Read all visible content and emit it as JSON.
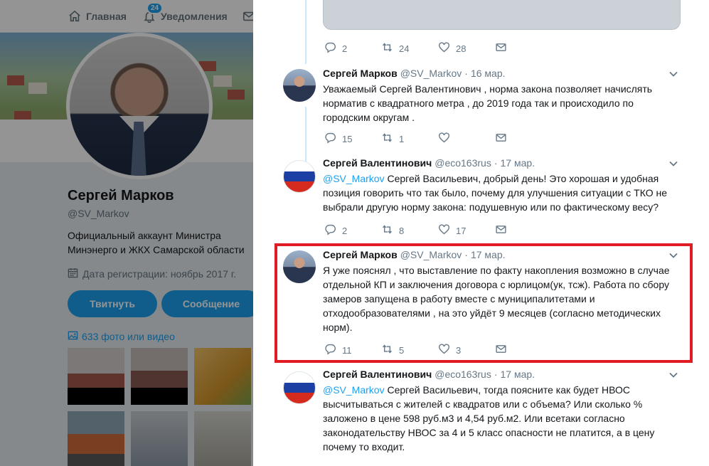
{
  "nav": {
    "home_label": "Главная",
    "notifications_label": "Уведомления",
    "notifications_count": "24"
  },
  "profile": {
    "name": "Сергей Марков",
    "handle": "@SV_Markov",
    "bio": "Официальный аккаунт Министра Минэнерго и ЖКХ Самарской области",
    "joined": "Дата регистрации: ноябрь 2017 г.",
    "tweet_button": "Твитнуть",
    "message_button": "Сообщение",
    "media_link": "633 фото или видео"
  },
  "thread": {
    "top_actions": {
      "replies": "2",
      "retweets": "24",
      "likes": "28"
    },
    "tweets": [
      {
        "name": "Сергей Марков",
        "handle": "@SV_Markov",
        "sep": "·",
        "date": "16 мар.",
        "mention": "",
        "text": "Уважаемый Сергей Валентинович , норма закона позволяет начислять норматив с квадратного метра , до 2019 года так и происходило по городским округам .",
        "replies": "15",
        "retweets": "1",
        "likes": ""
      },
      {
        "name": "Сергей Валентинович",
        "handle": "@eco163rus",
        "sep": "·",
        "date": "17 мар.",
        "mention": "@SV_Markov",
        "text": " Сергей Васильевич, добрый день! Это хорошая и удобная позиция говорить что так было, почему для улучшения ситуации с ТКО не выбрали другую норму закона: подушевную или по фактическому весу?",
        "replies": "2",
        "retweets": "8",
        "likes": "17"
      },
      {
        "name": "Сергей Марков",
        "handle": "@SV_Markov",
        "sep": "·",
        "date": "17 мар.",
        "mention": "",
        "text": "Я уже пояснял , что выставление по факту накопления возможно в случае отдельной КП и заключения договора с юрлицом(ук, тсж). Работа по сбору замеров запущена в работу вместе с муниципалитетами и отходообразователями , на это уйдёт 9 месяцев (согласно методических норм).",
        "replies": "11",
        "retweets": "5",
        "likes": "3"
      },
      {
        "name": "Сергей Валентинович",
        "handle": "@eco163rus",
        "sep": "·",
        "date": "17 мар.",
        "mention": "@SV_Markov",
        "text": " Сергей Васильевич, тогда поясните как будет НВОС высчитываться с жителей с квадратов или с объема? Или сколько % заложено в цене 598 руб.м3 и 4,54 руб.м2. Или всетаки согласно законодательству НВОС за 4 и 5 класс опасности не платится, а в цену почему то входит.",
        "replies": "",
        "retweets": "",
        "likes": ""
      }
    ]
  },
  "colors": {
    "accent": "#1da1f2",
    "highlight": "#e01b24"
  }
}
